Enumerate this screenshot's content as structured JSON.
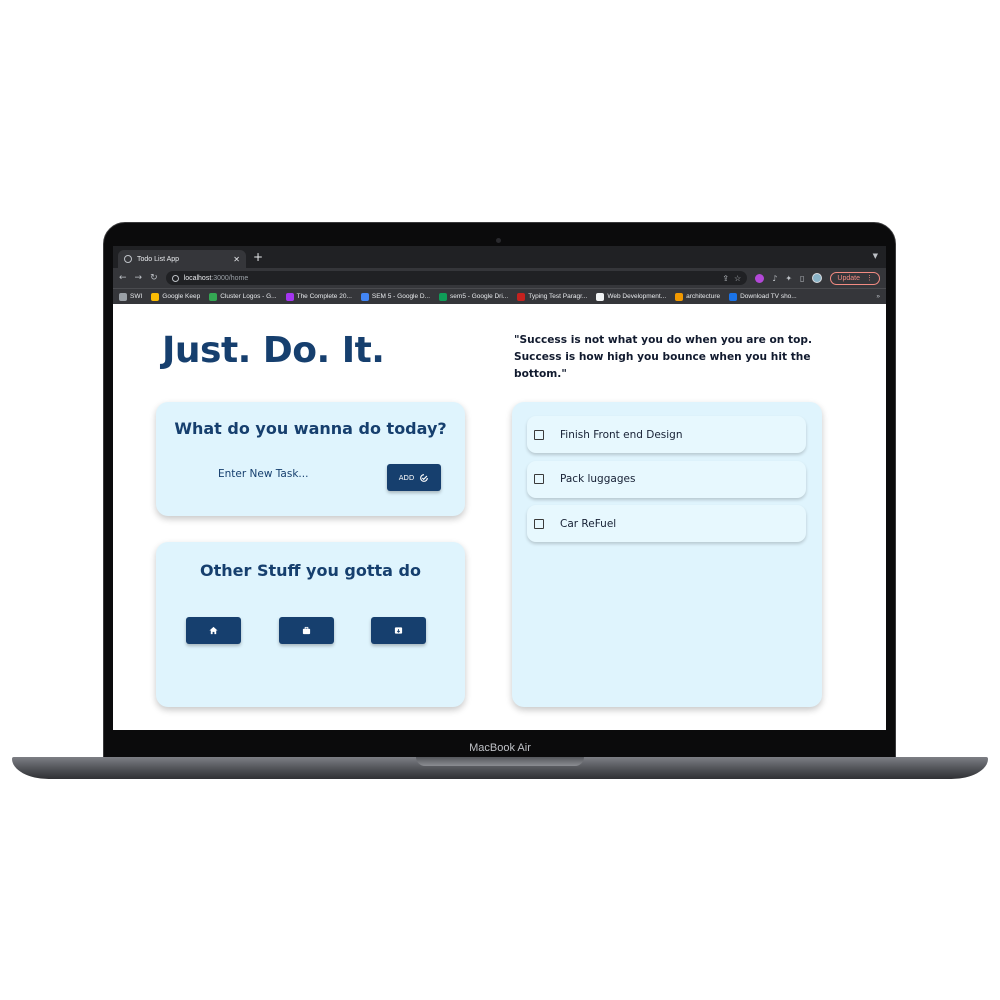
{
  "device": {
    "brand": "MacBook Air"
  },
  "browser": {
    "tab_title": "Todo List App",
    "tab_close": "✕",
    "new_tab": "+",
    "url_host": "localhost",
    "url_path": ":3000/home",
    "update_label": "Update",
    "bookmarks": [
      {
        "label": "SWI",
        "color": "#9aa0a6"
      },
      {
        "label": "Google Keep",
        "color": "#fbbc04"
      },
      {
        "label": "Cluster Logos - G...",
        "color": "#34a853"
      },
      {
        "label": "The Complete 20...",
        "color": "#a435f0"
      },
      {
        "label": "SEM 5 - Google D...",
        "color": "#4285f4"
      },
      {
        "label": "sem5 - Google Dri...",
        "color": "#0f9d58"
      },
      {
        "label": "Typing Test Paragr...",
        "color": "#c5221f"
      },
      {
        "label": "Web Development...",
        "color": "#f1f3f4"
      },
      {
        "label": "architecture",
        "color": "#f29900"
      },
      {
        "label": "Download TV sho...",
        "color": "#1a73e8"
      }
    ],
    "bookmarks_more": "»"
  },
  "page": {
    "hero_title": "Just. Do. It.",
    "quote": "\"Success is not what you do when you are on top. Success is how high you bounce when you hit the bottom.\"",
    "task_card": {
      "title": "What do you wanna do today?",
      "input_placeholder": "Enter New Task...",
      "add_label": "ADD"
    },
    "other_card": {
      "title": "Other Stuff you gotta do",
      "buttons": [
        "home-icon",
        "briefcase-icon",
        "archive-icon"
      ]
    },
    "todos": [
      {
        "text": "Finish Front end Design",
        "checked": false
      },
      {
        "text": "Pack luggages",
        "checked": false
      },
      {
        "text": "Car ReFuel",
        "checked": false
      }
    ]
  },
  "colors": {
    "primary": "#163f6e",
    "card_bg": "#dff4fd",
    "chrome_dark": "#202124"
  }
}
